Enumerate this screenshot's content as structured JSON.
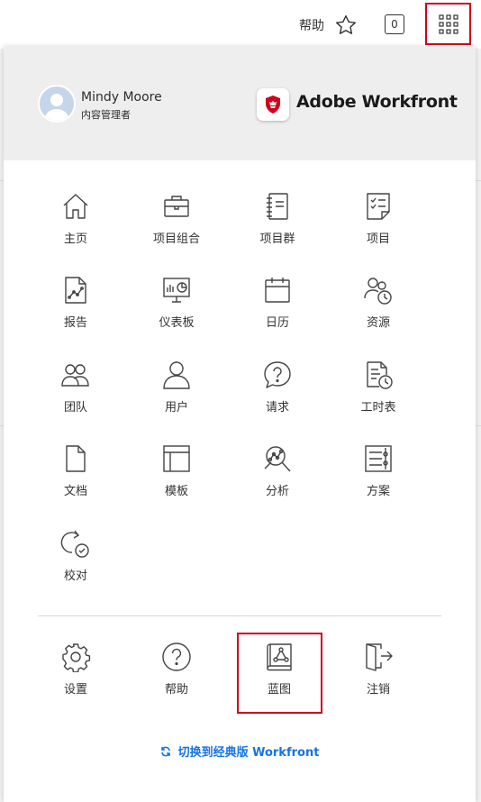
{
  "topbar": {
    "help_label": "帮助",
    "star_icon": "star-icon",
    "notification_count": "0",
    "apps_icon": "grid-icon"
  },
  "user": {
    "name": "Mindy Moore",
    "role": "内容管理者"
  },
  "brand": {
    "name": "Adobe Workfront",
    "logo_icon": "workfront-logo-icon",
    "logo_color": "#d0021b"
  },
  "menu": {
    "items": [
      {
        "label": "主页",
        "icon": "home-icon"
      },
      {
        "label": "项目组合",
        "icon": "briefcase-icon"
      },
      {
        "label": "项目群",
        "icon": "notebook-icon"
      },
      {
        "label": "项目",
        "icon": "checklist-icon"
      },
      {
        "label": "报告",
        "icon": "report-icon"
      },
      {
        "label": "仪表板",
        "icon": "dashboard-icon"
      },
      {
        "label": "日历",
        "icon": "calendar-icon"
      },
      {
        "label": "资源",
        "icon": "resources-icon"
      },
      {
        "label": "团队",
        "icon": "team-icon"
      },
      {
        "label": "用户",
        "icon": "user-icon"
      },
      {
        "label": "请求",
        "icon": "request-icon"
      },
      {
        "label": "工时表",
        "icon": "timesheet-icon"
      },
      {
        "label": "文档",
        "icon": "document-icon"
      },
      {
        "label": "模板",
        "icon": "template-icon"
      },
      {
        "label": "分析",
        "icon": "analytics-icon"
      },
      {
        "label": "方案",
        "icon": "scenario-icon"
      },
      {
        "label": "校对",
        "icon": "proof-icon"
      }
    ],
    "footer_items": [
      {
        "label": "设置",
        "icon": "gear-icon"
      },
      {
        "label": "帮助",
        "icon": "help-icon"
      },
      {
        "label": "蓝图",
        "icon": "blueprint-icon"
      },
      {
        "label": "注销",
        "icon": "logout-icon"
      }
    ],
    "switch_label": "切换到经典版 Workfront",
    "accent_color": "#1473e6"
  }
}
